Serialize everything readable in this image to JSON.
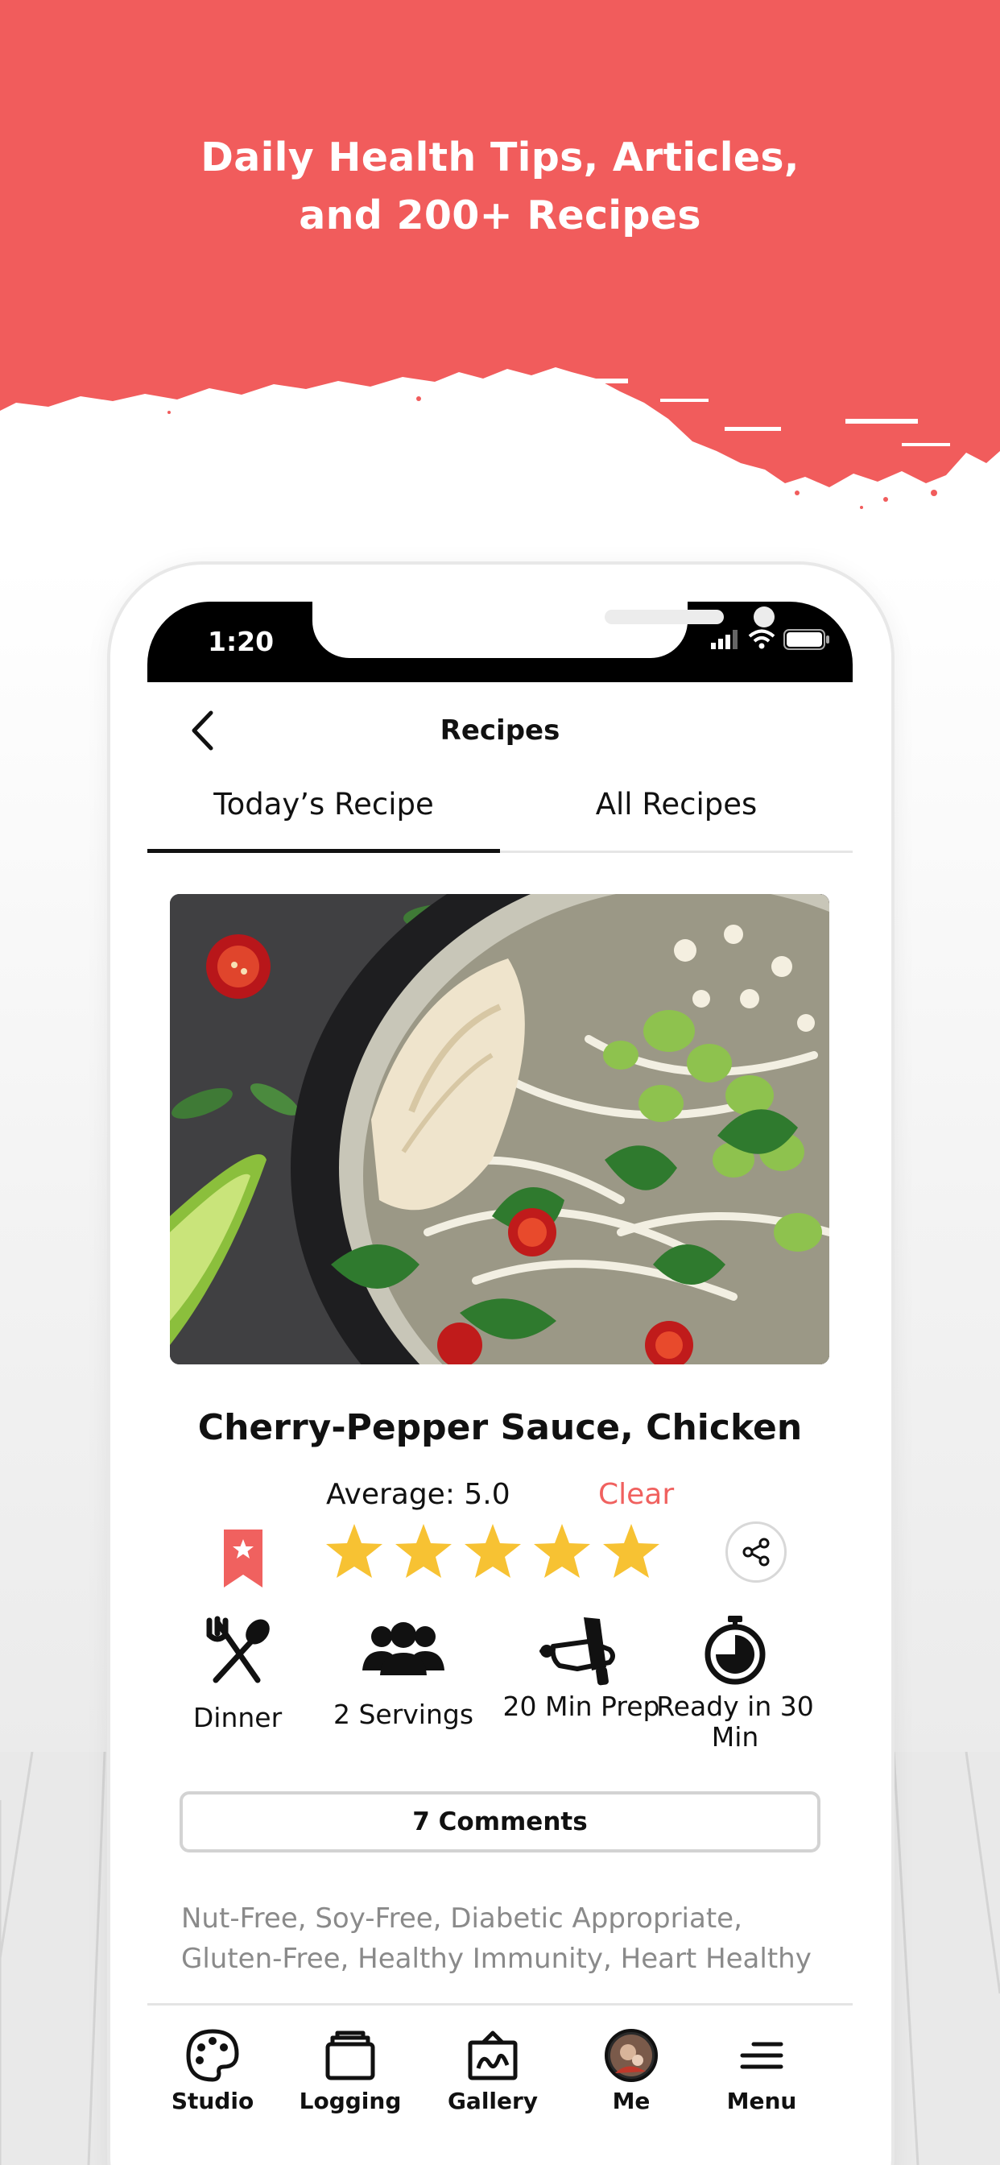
{
  "promo": {
    "headline_line1": "Daily Health Tips, Articles,",
    "headline_line2": "and 200+ Recipes",
    "band_color": "#f15c5c"
  },
  "status_bar": {
    "time": "1:20"
  },
  "header": {
    "title": "Recipes",
    "back_icon": "chevron-left-icon"
  },
  "tabs": [
    {
      "label": "Today’s Recipe",
      "active": true
    },
    {
      "label": "All Recipes",
      "active": false
    }
  ],
  "recipe": {
    "title": "Cherry-Pepper Sauce, Chicken",
    "average_label": "Average: 5.0",
    "clear_label": "Clear",
    "rating": 5,
    "max_rating": 5,
    "details": [
      {
        "icon": "utensils-icon",
        "label": "Dinner"
      },
      {
        "icon": "people-icon",
        "label": "2 Servings"
      },
      {
        "icon": "cutting-board-icon",
        "label": "20 Min Prep"
      },
      {
        "icon": "timer-icon",
        "label": "Ready in 30 Min"
      }
    ],
    "comments_label": "7 Comments",
    "tags": "Nut-Free, Soy-Free, Diabetic Appropriate, Gluten-Free, Healthy Immunity, Heart Healthy"
  },
  "bottom_nav": [
    {
      "icon": "palette-icon",
      "label": "Studio"
    },
    {
      "icon": "folder-icon",
      "label": "Logging"
    },
    {
      "icon": "gallery-icon",
      "label": "Gallery"
    },
    {
      "icon": "avatar-icon",
      "label": "Me"
    },
    {
      "icon": "menu-icon",
      "label": "Menu"
    }
  ],
  "colors": {
    "accent": "#f0615f",
    "star": "#f7c233",
    "text": "#111111",
    "muted": "#8a8a8a"
  }
}
